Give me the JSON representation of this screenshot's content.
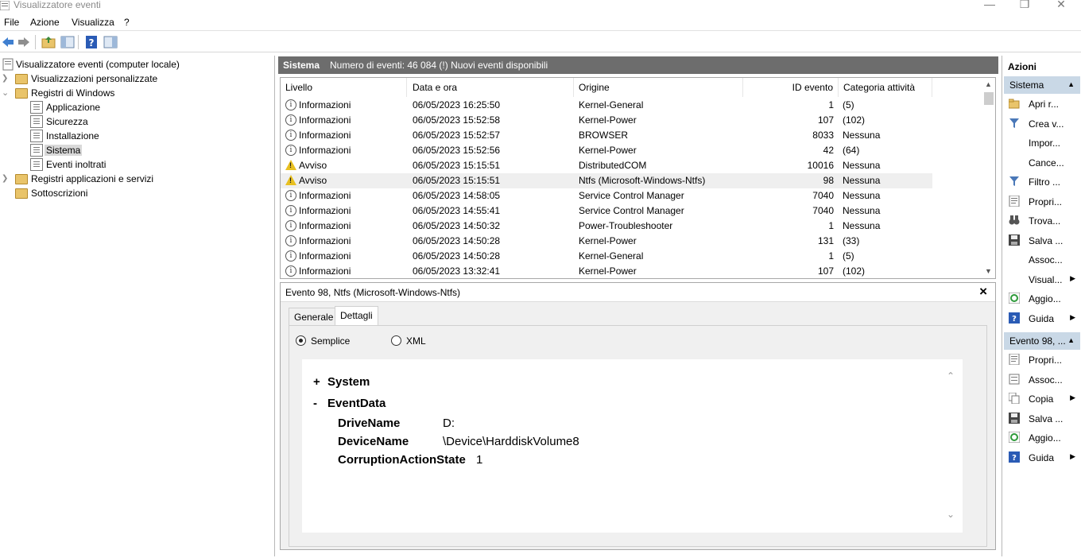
{
  "window": {
    "title": "Visualizzatore eventi"
  },
  "menu": [
    "File",
    "Azione",
    "Visualizza",
    "?"
  ],
  "tree": {
    "root": "Visualizzatore eventi (computer locale)",
    "custom_views": "Visualizzazioni personalizzate",
    "windows_logs": "Registri di Windows",
    "logs": [
      "Applicazione",
      "Sicurezza",
      "Installazione",
      "Sistema",
      "Eventi inoltrati"
    ],
    "app_services": "Registri applicazioni e servizi",
    "subscriptions": "Sottoscrizioni",
    "selected": "Sistema"
  },
  "center_header": {
    "title": "Sistema",
    "info": "Numero di eventi: 46 084 (!) Nuovi eventi disponibili"
  },
  "grid": {
    "columns": [
      "Livello",
      "Data e ora",
      "Origine",
      "ID evento",
      "Categoria attività"
    ],
    "rows": [
      {
        "level": "Informazioni",
        "icon": "info-icon",
        "date": "06/05/2023 16:25:50",
        "source": "Kernel-General",
        "id": "1",
        "category": "(5)"
      },
      {
        "level": "Informazioni",
        "icon": "info-icon",
        "date": "06/05/2023 15:52:58",
        "source": "Kernel-Power",
        "id": "107",
        "category": "(102)"
      },
      {
        "level": "Informazioni",
        "icon": "info-icon",
        "date": "06/05/2023 15:52:57",
        "source": "BROWSER",
        "id": "8033",
        "category": "Nessuna"
      },
      {
        "level": "Informazioni",
        "icon": "info-icon",
        "date": "06/05/2023 15:52:56",
        "source": "Kernel-Power",
        "id": "42",
        "category": "(64)"
      },
      {
        "level": "Avviso",
        "icon": "warning-icon",
        "date": "06/05/2023 15:15:51",
        "source": "DistributedCOM",
        "id": "10016",
        "category": "Nessuna"
      },
      {
        "level": "Avviso",
        "icon": "warning-icon",
        "date": "06/05/2023 15:15:51",
        "source": "Ntfs (Microsoft-Windows-Ntfs)",
        "id": "98",
        "category": "Nessuna"
      },
      {
        "level": "Informazioni",
        "icon": "info-icon",
        "date": "06/05/2023 14:58:05",
        "source": "Service Control Manager",
        "id": "7040",
        "category": "Nessuna"
      },
      {
        "level": "Informazioni",
        "icon": "info-icon",
        "date": "06/05/2023 14:55:41",
        "source": "Service Control Manager",
        "id": "7040",
        "category": "Nessuna"
      },
      {
        "level": "Informazioni",
        "icon": "info-icon",
        "date": "06/05/2023 14:50:32",
        "source": "Power-Troubleshooter",
        "id": "1",
        "category": "Nessuna"
      },
      {
        "level": "Informazioni",
        "icon": "info-icon",
        "date": "06/05/2023 14:50:28",
        "source": "Kernel-Power",
        "id": "131",
        "category": "(33)"
      },
      {
        "level": "Informazioni",
        "icon": "info-icon",
        "date": "06/05/2023 14:50:28",
        "source": "Kernel-General",
        "id": "1",
        "category": "(5)"
      },
      {
        "level": "Informazioni",
        "icon": "info-icon",
        "date": "06/05/2023 13:32:41",
        "source": "Kernel-Power",
        "id": "107",
        "category": "(102)"
      }
    ],
    "selected_row": 5
  },
  "detail": {
    "title": "Evento 98, Ntfs (Microsoft-Windows-Ntfs)",
    "tabs": [
      "Generale",
      "Dettagli"
    ],
    "active_tab": "Dettagli",
    "view_options": [
      "Semplice",
      "XML"
    ],
    "selected_view": "Semplice",
    "system_node": "System",
    "system_toggle": "+",
    "eventdata_node": "EventData",
    "eventdata_toggle": "-",
    "fields": [
      {
        "name": "DriveName",
        "value": "D:"
      },
      {
        "name": "DeviceName",
        "value": "\\Device\\HarddiskVolume8"
      },
      {
        "name": "CorruptionActionState",
        "value": "1"
      }
    ]
  },
  "actions": {
    "header": "Azioni",
    "section1": "Sistema",
    "items1": [
      {
        "label": "Apri r...",
        "icon": "open-folder-icon",
        "submenu": false
      },
      {
        "label": "Crea v...",
        "icon": "filter-icon",
        "submenu": false
      },
      {
        "label": "Impor...",
        "icon": "",
        "submenu": false
      },
      {
        "label": "Cance...",
        "icon": "",
        "submenu": false
      },
      {
        "label": "Filtro ...",
        "icon": "filter-icon",
        "submenu": false
      },
      {
        "label": "Propri...",
        "icon": "properties-icon",
        "submenu": false
      },
      {
        "label": "Trova...",
        "icon": "binoculars-icon",
        "submenu": false
      },
      {
        "label": "Salva ...",
        "icon": "save-icon",
        "submenu": false
      },
      {
        "label": "Assoc...",
        "icon": "",
        "submenu": false
      },
      {
        "label": "Visual...",
        "icon": "",
        "submenu": true
      },
      {
        "label": "Aggio...",
        "icon": "refresh-icon",
        "submenu": false
      },
      {
        "label": "Guida",
        "icon": "help-icon",
        "submenu": true
      }
    ],
    "section2": "Evento 98, ...",
    "items2": [
      {
        "label": "Propri...",
        "icon": "properties-icon",
        "submenu": false
      },
      {
        "label": "Assoc...",
        "icon": "task-icon",
        "submenu": false
      },
      {
        "label": "Copia",
        "icon": "copy-icon",
        "submenu": true
      },
      {
        "label": "Salva ...",
        "icon": "save-icon",
        "submenu": false
      },
      {
        "label": "Aggio...",
        "icon": "refresh-icon",
        "submenu": false
      },
      {
        "label": "Guida",
        "icon": "help-icon",
        "submenu": true
      }
    ]
  },
  "colors": {
    "header_bar": "#6d6d6d",
    "section_bar": "#c9d8e6",
    "warning": "#e8c020"
  }
}
